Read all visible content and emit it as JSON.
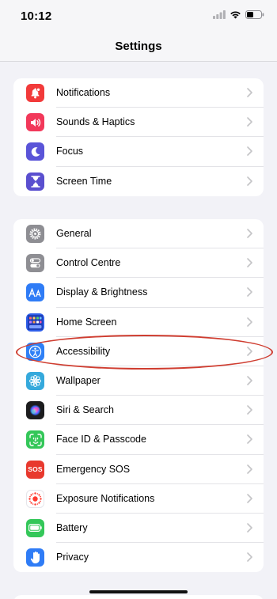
{
  "status_bar": {
    "time": "10:12",
    "icons": [
      "cellular-signal-icon",
      "wifi-icon",
      "battery-icon"
    ]
  },
  "nav": {
    "title": "Settings"
  },
  "groups": [
    {
      "items": [
        {
          "label": "Notifications",
          "icon": "bell-icon",
          "color": "#f23a3a"
        },
        {
          "label": "Sounds & Haptics",
          "icon": "speaker-icon",
          "color": "#f2385a"
        },
        {
          "label": "Focus",
          "icon": "moon-icon",
          "color": "#5a54d8"
        },
        {
          "label": "Screen Time",
          "icon": "hourglass-icon",
          "color": "#5a4fcf"
        }
      ]
    },
    {
      "items": [
        {
          "label": "General",
          "icon": "gear-icon",
          "color": "#8e8e93"
        },
        {
          "label": "Control Centre",
          "icon": "toggle-icon",
          "color": "#8e8e93"
        },
        {
          "label": "Display & Brightness",
          "icon": "text-size-icon",
          "color": "#2f7cf6"
        },
        {
          "label": "Home Screen",
          "icon": "app-grid-icon",
          "color": "#2f5ee8"
        },
        {
          "label": "Accessibility",
          "icon": "accessibility-icon",
          "color": "#2f80f6"
        },
        {
          "label": "Wallpaper",
          "icon": "flower-icon",
          "color": "#35a9dc"
        },
        {
          "label": "Siri & Search",
          "icon": "siri-icon",
          "color": "#1c1c1e"
        },
        {
          "label": "Face ID & Passcode",
          "icon": "face-id-icon",
          "color": "#34c759"
        },
        {
          "label": "Emergency SOS",
          "icon": "sos-icon",
          "color": "#e8392e",
          "icon_text": "SOS"
        },
        {
          "label": "Exposure Notifications",
          "icon": "exposure-icon",
          "color": "#ffffff"
        },
        {
          "label": "Battery",
          "icon": "battery-setting-icon",
          "color": "#34c759"
        },
        {
          "label": "Privacy",
          "icon": "hand-icon",
          "color": "#2f7cf6"
        }
      ]
    }
  ],
  "annotation": {
    "target": "Accessibility",
    "color": "#cf3d30"
  }
}
